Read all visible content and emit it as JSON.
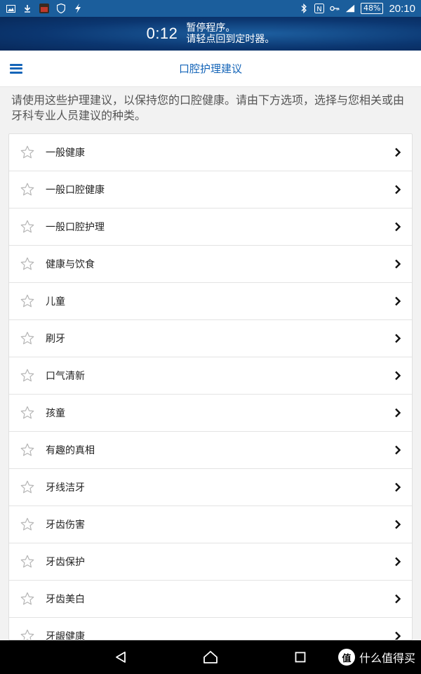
{
  "status_bar": {
    "time": "20:10",
    "battery": "48%",
    "icons_left": [
      "image-icon",
      "download-icon",
      "app-icon",
      "shield-icon",
      "flash-icon"
    ],
    "icons_right": [
      "bluetooth-icon",
      "nfc-icon",
      "key-icon",
      "signal-icon"
    ]
  },
  "timer_banner": {
    "time": "0:12",
    "line1": "暂停程序。",
    "line2": "请轻点回到定时器。"
  },
  "app_bar": {
    "title": "口腔护理建议",
    "accent_color": "#1565b8"
  },
  "intro": {
    "text": "请使用这些护理建议，以保持您的口腔健康。请由下方选项，选择与您相关或由牙科专业人员建议的种类。"
  },
  "list": {
    "items": [
      {
        "label": "一般健康"
      },
      {
        "label": "一般口腔健康"
      },
      {
        "label": "一般口腔护理"
      },
      {
        "label": "健康与饮食"
      },
      {
        "label": "儿童"
      },
      {
        "label": "刷牙"
      },
      {
        "label": "口气清新"
      },
      {
        "label": "孩童"
      },
      {
        "label": "有趣的真相"
      },
      {
        "label": "牙线洁牙"
      },
      {
        "label": "牙齿伤害"
      },
      {
        "label": "牙齿保护"
      },
      {
        "label": "牙齿美白"
      },
      {
        "label": "牙龈健康"
      }
    ]
  },
  "nav_bar": {
    "buttons": [
      "back-icon",
      "home-icon",
      "recents-icon"
    ]
  },
  "watermark": {
    "badge": "值",
    "text": "什么值得买"
  }
}
